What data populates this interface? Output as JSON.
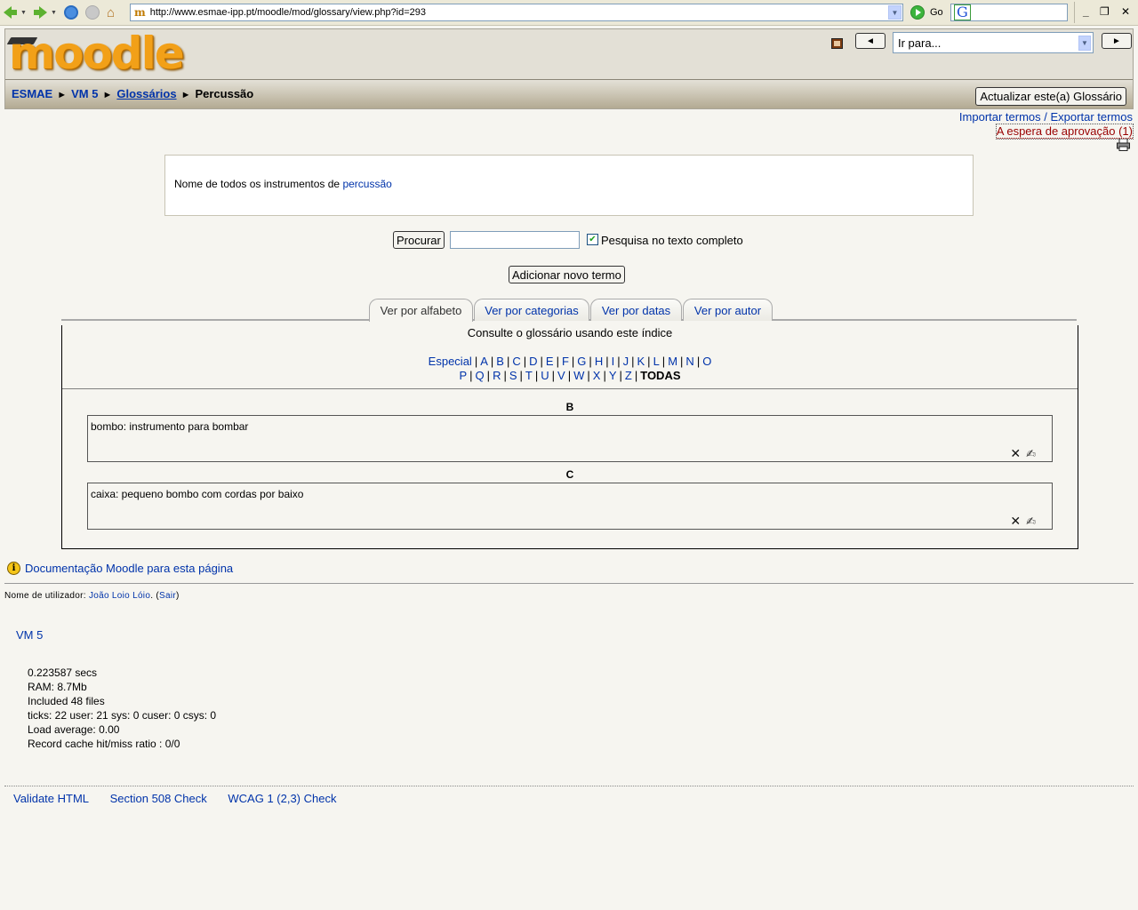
{
  "browser": {
    "url": "http://www.esmae-ipp.pt/moodle/mod/glossary/view.php?id=293",
    "go_label": "Go",
    "icons": [
      "back-icon",
      "forward-icon",
      "refresh-icon",
      "stop-icon",
      "home-icon"
    ],
    "window_controls": {
      "minimize": "_",
      "restore": "❐",
      "close": "✕"
    }
  },
  "header": {
    "logo_text": "moodle",
    "jump_prev": "◄",
    "jump_next": "►",
    "jump_select_value": "Ir para...",
    "breadcrumb": [
      {
        "label": "ESMAE",
        "link": true
      },
      {
        "label": "VM 5",
        "link": true
      },
      {
        "label": "Glossários",
        "link": true
      },
      {
        "label": "Percussão",
        "link": false
      }
    ],
    "breadcrumb_separator": "►",
    "update_button": "Actualizar este(a) Glossário"
  },
  "top_links": {
    "import": "Importar termos",
    "separator": " / ",
    "export": "Exportar termos",
    "pending": "A espera de aprovação (1)"
  },
  "intro": {
    "text": "Nome de todos os instrumentos de ",
    "link": "percussão"
  },
  "search": {
    "button": "Procurar",
    "value": "",
    "fulltext_checked": true,
    "fulltext_label": "Pesquisa no texto completo"
  },
  "add_button": "Adicionar novo termo",
  "tabs": [
    {
      "label": "Ver por alfabeto",
      "active": true
    },
    {
      "label": "Ver por categorias",
      "active": false
    },
    {
      "label": "Ver por datas",
      "active": false
    },
    {
      "label": "Ver por autor",
      "active": false
    }
  ],
  "index": {
    "title": "Consulte o glossário usando este índice",
    "row1": [
      "Especial",
      "A",
      "B",
      "C",
      "D",
      "E",
      "F",
      "G",
      "H",
      "I",
      "J",
      "K",
      "L",
      "M",
      "N",
      "O"
    ],
    "row2": [
      "P",
      "Q",
      "R",
      "S",
      "T",
      "U",
      "V",
      "W",
      "X",
      "Y",
      "Z"
    ],
    "all_label": "TODAS"
  },
  "entries": [
    {
      "letter": "B",
      "text": "bombo: instrumento para bombar"
    },
    {
      "letter": "C",
      "text": "caixa: pequeno bombo com cordas por baixo"
    }
  ],
  "footer": {
    "doc_link": "Documentação Moodle para esta página",
    "login_prefix": "Nome de utilizador: ",
    "user": "João Loio Lóio",
    "logout": "Sair",
    "course_link": "VM 5",
    "perf": [
      "0.223587 secs",
      "RAM: 8.7Mb",
      "Included 48 files",
      "ticks: 22 user: 21 sys: 0 cuser: 0 csys: 0",
      "Load average: 0.00",
      "Record cache hit/miss ratio : 0/0"
    ],
    "validators": [
      "Validate HTML",
      "Section 508 Check",
      "WCAG 1 (2,3) Check"
    ]
  }
}
